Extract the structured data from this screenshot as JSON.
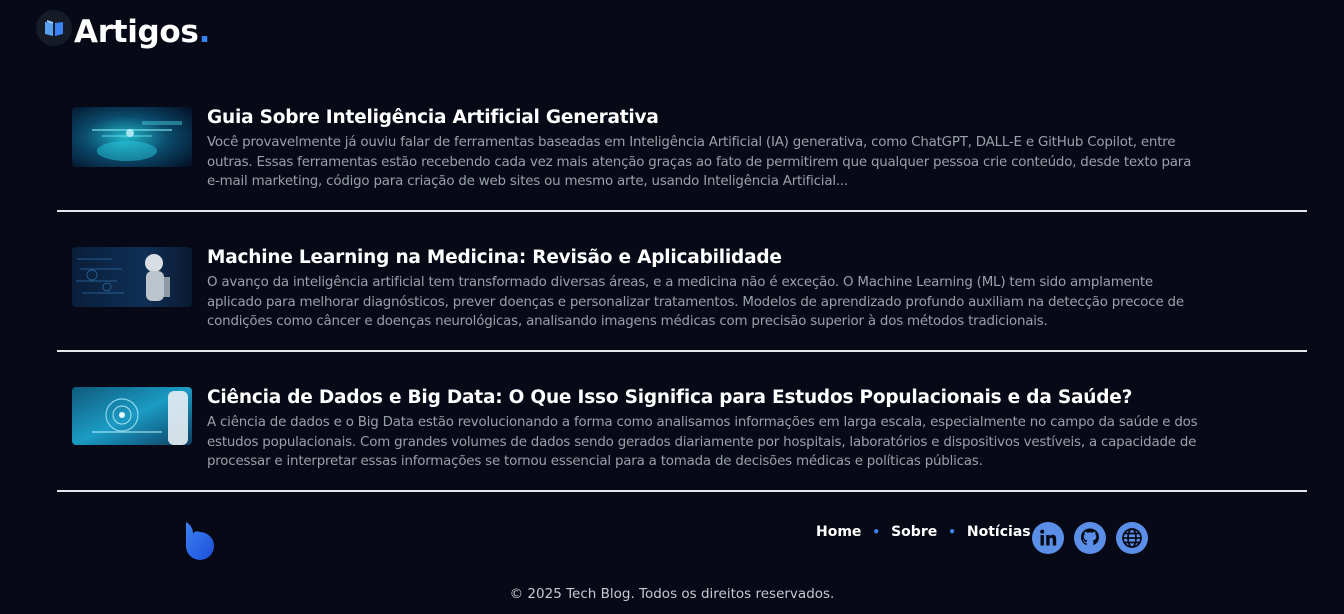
{
  "header": {
    "icon": "book-icon",
    "title": "Artigos",
    "title_dot": "."
  },
  "articles": [
    {
      "title": "Guia Sobre Inteligência Artificial Generativa",
      "excerpt": "Você provavelmente já ouviu falar de ferramentas baseadas em Inteligência Artificial (IA) generativa, como ChatGPT, DALL-E e GitHub Copilot, entre outras. Essas ferramentas estão recebendo cada vez mais atenção graças ao fato de permitirem que qualquer pessoa crie conteúdo, desde texto para e-mail marketing, código para criação de web sites ou mesmo arte, usando Inteligência Artificial..."
    },
    {
      "title": "Machine Learning na Medicina: Revisão e Aplicabilidade",
      "excerpt": "O avanço da inteligência artificial tem transformado diversas áreas, e a medicina não é exceção. O Machine Learning (ML) tem sido amplamente aplicado para melhorar diagnósticos, prever doenças e personalizar tratamentos. Modelos de aprendizado profundo auxiliam na detecção precoce de condições como câncer e doenças neurológicas, analisando imagens médicas com precisão superior à dos métodos tradicionais."
    },
    {
      "title": "Ciência de Dados e Big Data: O Que Isso Significa para Estudos Populacionais e da Saúde?",
      "excerpt": "A ciência de dados e o Big Data estão revolucionando a forma como analisamos informações em larga escala, especialmente no campo da saúde e dos estudos populacionais. Com grandes volumes de dados sendo gerados diariamente por hospitais, laboratórios e dispositivos vestíveis, a capacidade de processar e interpretar essas informações se tornou essencial para a tomada de decisões médicas e políticas públicas."
    }
  ],
  "footer": {
    "nav": [
      "Home",
      "Sobre",
      "Notícias"
    ],
    "nav_separator": "•",
    "social": [
      "linkedin-icon",
      "github-icon",
      "globe-icon"
    ],
    "copyright": "© 2025 Tech Blog. Todos os direitos reservados."
  },
  "colors": {
    "background": "#070a16",
    "accent": "#3b82f6",
    "social_icon": "#5b8ee6",
    "divider": "#e5e7eb"
  }
}
